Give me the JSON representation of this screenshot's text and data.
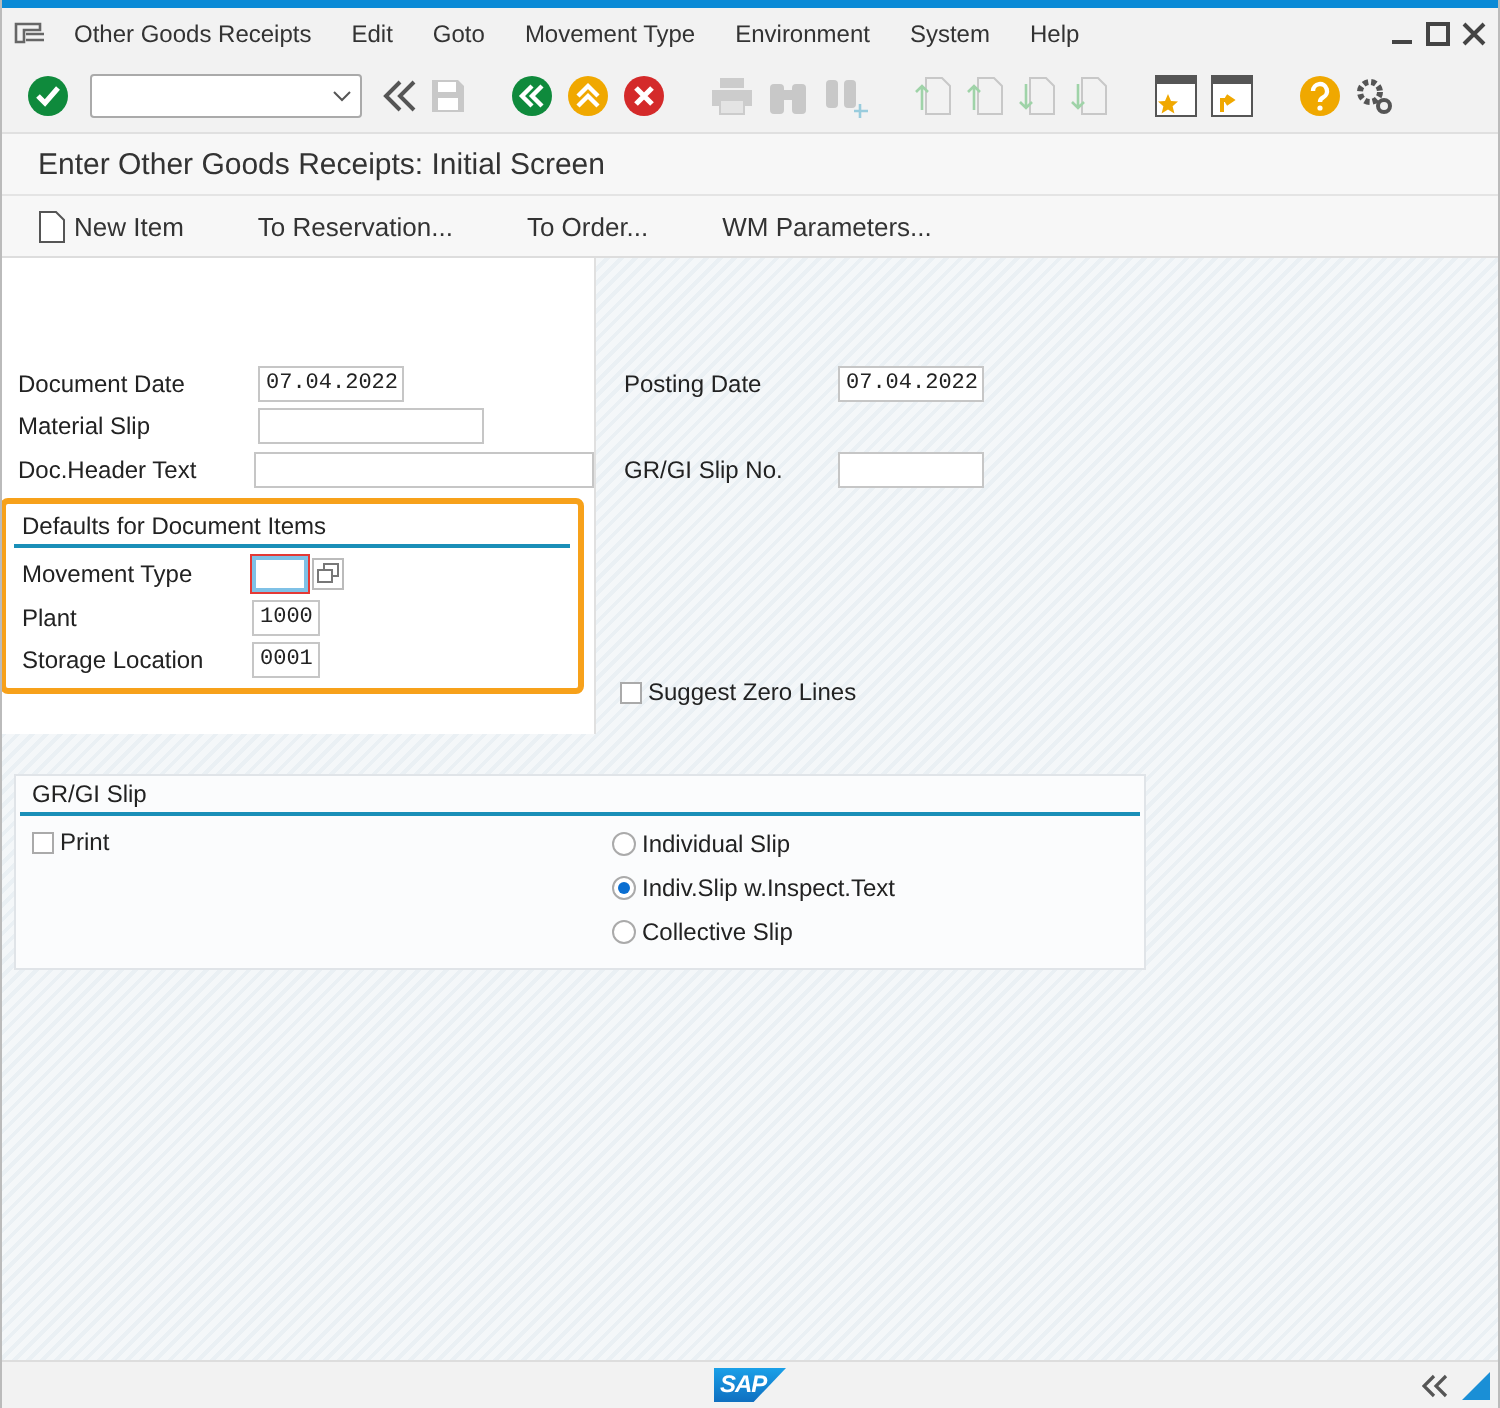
{
  "menu": [
    {
      "label": "Other Goods Receipts"
    },
    {
      "label": "Edit"
    },
    {
      "label": "Goto"
    },
    {
      "label": "Movement Type"
    },
    {
      "label": "Environment"
    },
    {
      "label": "System"
    },
    {
      "label": "Help"
    }
  ],
  "title": "Enter Other Goods Receipts: Initial Screen",
  "app_toolbar": [
    {
      "label": "New Item",
      "kind": "icon"
    },
    {
      "label": "To Reservation...",
      "kind": "text"
    },
    {
      "label": "To Order...",
      "kind": "text"
    },
    {
      "label": "WM Parameters...",
      "kind": "text"
    }
  ],
  "fields": [
    {
      "label": "Document Date",
      "value": "07.04.2022"
    },
    {
      "label": "Material Slip"
    },
    {
      "label": "Doc.Header Text"
    }
  ],
  "right_fields": [
    {
      "label": "Posting Date",
      "value": "07.04.2022"
    },
    {
      "label": "GR/GI Slip No."
    }
  ],
  "defaults_group": {
    "title": "Defaults for Document Items",
    "highlighted": true,
    "fields": [
      {
        "label": "Movement Type",
        "focused": true
      },
      {
        "label": "Plant",
        "value": "1000",
        "focused": false
      },
      {
        "label": "Storage Location",
        "value": "0001",
        "focused": false
      }
    ]
  },
  "suggest_zero_lines": {
    "label": "Suggest Zero Lines",
    "checked": false
  },
  "slip_group": {
    "title": "GR/GI Slip",
    "print": {
      "label": "Print",
      "checked": false
    },
    "options": [
      {
        "label": "Individual Slip",
        "selected": false
      },
      {
        "label": "Indiv.Slip w.Inspect.Text",
        "selected": true
      },
      {
        "label": "Collective Slip",
        "selected": false
      }
    ]
  },
  "footer": {
    "logo": "SAP"
  }
}
